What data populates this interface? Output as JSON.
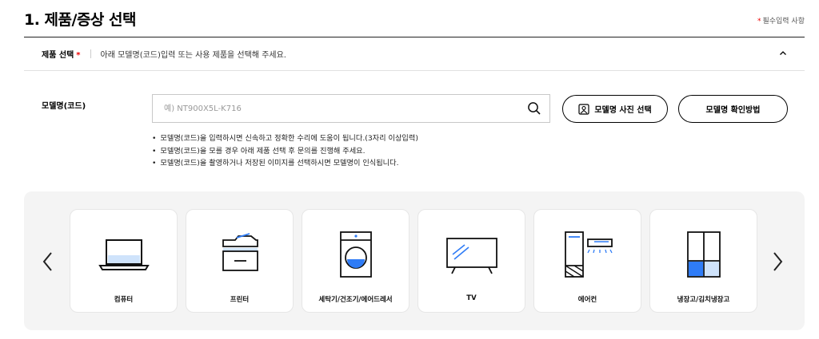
{
  "page": {
    "title": "1. 제품/증상 선택",
    "required_note_star": "*",
    "required_note": "필수입력 사항"
  },
  "product_selection": {
    "label": "제품 선택",
    "star": "*",
    "description": "아래 모델명(코드)입력 또는 사용 제품을 선택해 주세요."
  },
  "model": {
    "label": "모델명(코드)",
    "placeholder": "예) NT900X5L-K716",
    "value": "",
    "photo_button": "모델명 사진 선택",
    "help_button": "모델명 확인방법",
    "hints": [
      "모델명(코드)을 입력하시면 신속하고 정확한 수리에 도움이 됩니다.(3자리 이상입력)",
      "모델명(코드)을 모를 경우 아래 제품 선택 후 문의를 진행해 주세요.",
      "모델명(코드)을 촬영하거나 저장된 이미지를 선택하시면 모델명이 인식됩니다."
    ]
  },
  "categories": [
    {
      "label": "컴퓨터",
      "icon": "laptop-icon"
    },
    {
      "label": "프린터",
      "icon": "printer-icon"
    },
    {
      "label": "세탁기/건조기/에어드레서",
      "icon": "washer-icon"
    },
    {
      "label": "TV",
      "icon": "tv-icon"
    },
    {
      "label": "에어컨",
      "icon": "air-conditioner-icon"
    },
    {
      "label": "냉장고/김치냉장고",
      "icon": "refrigerator-icon"
    }
  ],
  "colors": {
    "accent_blue": "#2f7cf6",
    "light_blue": "#cfe3fb",
    "required_red": "#e00000",
    "panel_bg": "#f4f4f4"
  }
}
